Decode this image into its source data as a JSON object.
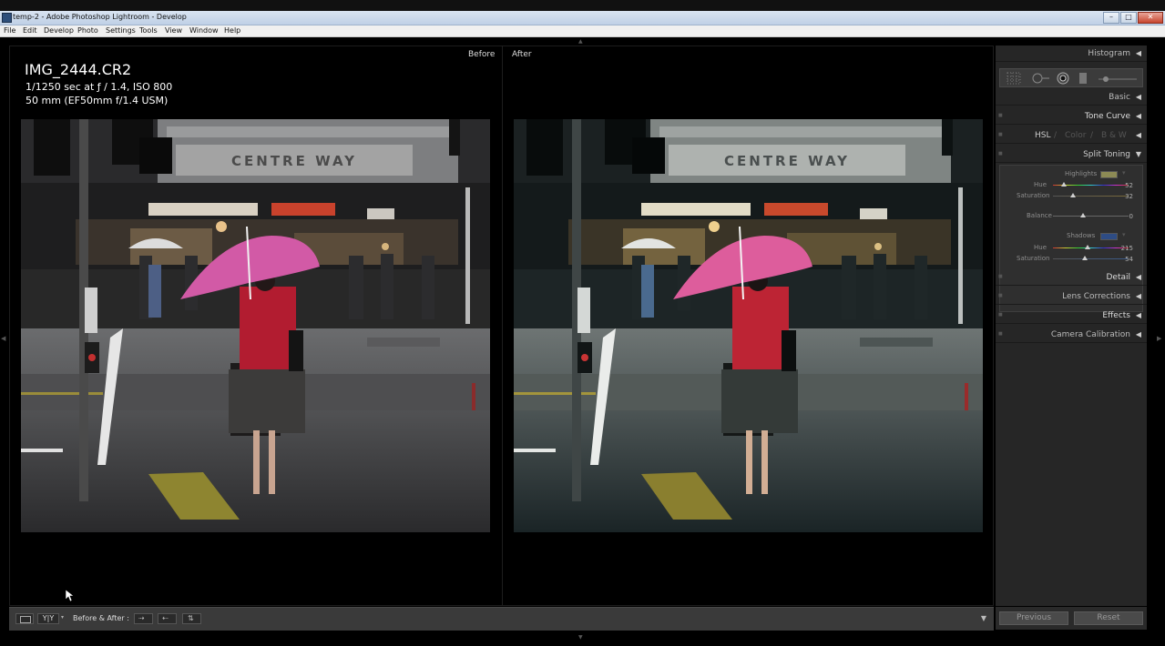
{
  "window": {
    "title": "temp-2 - Adobe Photoshop Lightroom - Develop",
    "minimize": "–",
    "maximize": "□",
    "close": "✕"
  },
  "menu": [
    "File",
    "Edit",
    "Develop",
    "Photo",
    "Settings",
    "Tools",
    "View",
    "Window",
    "Help"
  ],
  "viewer": {
    "before_label": "Before",
    "after_label": "After",
    "filename": "IMG_2444.CR2",
    "exposure": "1/1250 sec at ƒ / 1.4, ISO 800",
    "lens": "50 mm (EF50mm f/1.4 USM)",
    "sign_text": "CENTRE WAY"
  },
  "toolbar": {
    "view_mode": "Y|Y",
    "before_after_label": "Before & After :"
  },
  "panels": {
    "histogram": "Histogram",
    "basic": "Basic",
    "tone_curve": "Tone Curve",
    "hsl": "HSL",
    "hsl_sep1": "/",
    "color": "Color",
    "hsl_sep2": "/",
    "bw": "B & W",
    "split_toning": "Split Toning",
    "detail": "Detail",
    "lens_corrections": "Lens Corrections",
    "effects": "Effects",
    "camera_calibration": "Camera Calibration"
  },
  "split_toning": {
    "highlights_label": "Highlights",
    "highlights_hue_label": "Hue",
    "highlights_hue": "52",
    "highlights_saturation_label": "Saturation",
    "highlights_saturation": "32",
    "balance_label": "Balance",
    "balance": "0",
    "shadows_label": "Shadows",
    "shadows_hue_label": "Hue",
    "shadows_hue": "215",
    "shadows_saturation_label": "Saturation",
    "shadows_saturation": "54",
    "highlight_swatch_color": "#8c8a55",
    "shadow_swatch_color": "#2e4c84"
  },
  "buttons": {
    "previous": "Previous",
    "reset": "Reset"
  }
}
